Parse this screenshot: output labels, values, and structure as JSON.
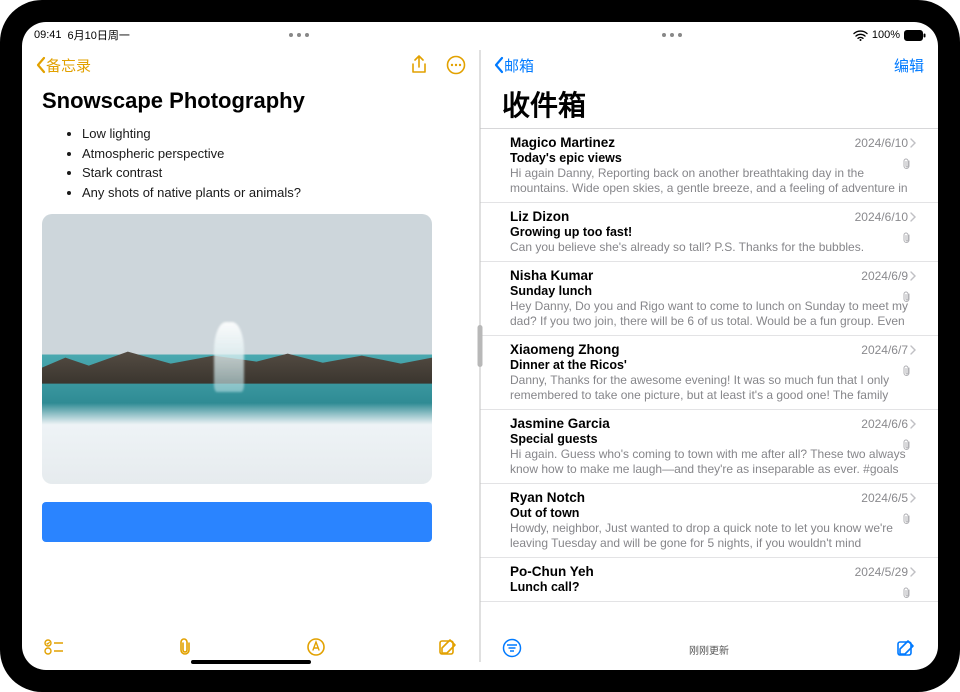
{
  "status": {
    "time": "09:41",
    "date": "6月10日周一",
    "battery": "100%"
  },
  "notes": {
    "back_label": "备忘录",
    "title": "Snowscape Photography",
    "bullets": [
      "Low lighting",
      "Atmospheric perspective",
      "Stark contrast",
      "Any shots of native plants or animals?"
    ]
  },
  "mail": {
    "back_label": "邮箱",
    "edit_label": "编辑",
    "inbox_title": "收件箱",
    "status_text": "刚刚更新",
    "messages": [
      {
        "sender": "Magico Martinez",
        "date": "2024/6/10",
        "subject": "Today's epic views",
        "preview": "Hi again Danny, Reporting back on another breathtaking day in the mountains. Wide open skies, a gentle breeze, and a feeling of adventure in the air. I felt l…"
      },
      {
        "sender": "Liz Dizon",
        "date": "2024/6/10",
        "subject": "Growing up too fast!",
        "preview": "Can you believe she's already so tall? P.S. Thanks for the bubbles."
      },
      {
        "sender": "Nisha Kumar",
        "date": "2024/6/9",
        "subject": "Sunday lunch",
        "preview": "Hey Danny, Do you and Rigo want to come to lunch on Sunday to meet my dad? If you two join, there will be 6 of us total. Would be a fun group. Even if…"
      },
      {
        "sender": "Xiaomeng Zhong",
        "date": "2024/6/7",
        "subject": "Dinner at the Ricos'",
        "preview": "Danny, Thanks for the awesome evening! It was so much fun that I only remembered to take one picture, but at least it's a good one! The family and…"
      },
      {
        "sender": "Jasmine Garcia",
        "date": "2024/6/6",
        "subject": "Special guests",
        "preview": "Hi again. Guess who's coming to town with me after all? These two always know how to make me laugh—and they're as inseparable as ever. #goals"
      },
      {
        "sender": "Ryan Notch",
        "date": "2024/6/5",
        "subject": "Out of town",
        "preview": "Howdy, neighbor, Just wanted to drop a quick note to let you know we're leaving Tuesday and will be gone for 5 nights, if you wouldn't mind keeping…"
      },
      {
        "sender": "Po-Chun Yeh",
        "date": "2024/5/29",
        "subject": "Lunch call?",
        "preview": ""
      }
    ]
  }
}
